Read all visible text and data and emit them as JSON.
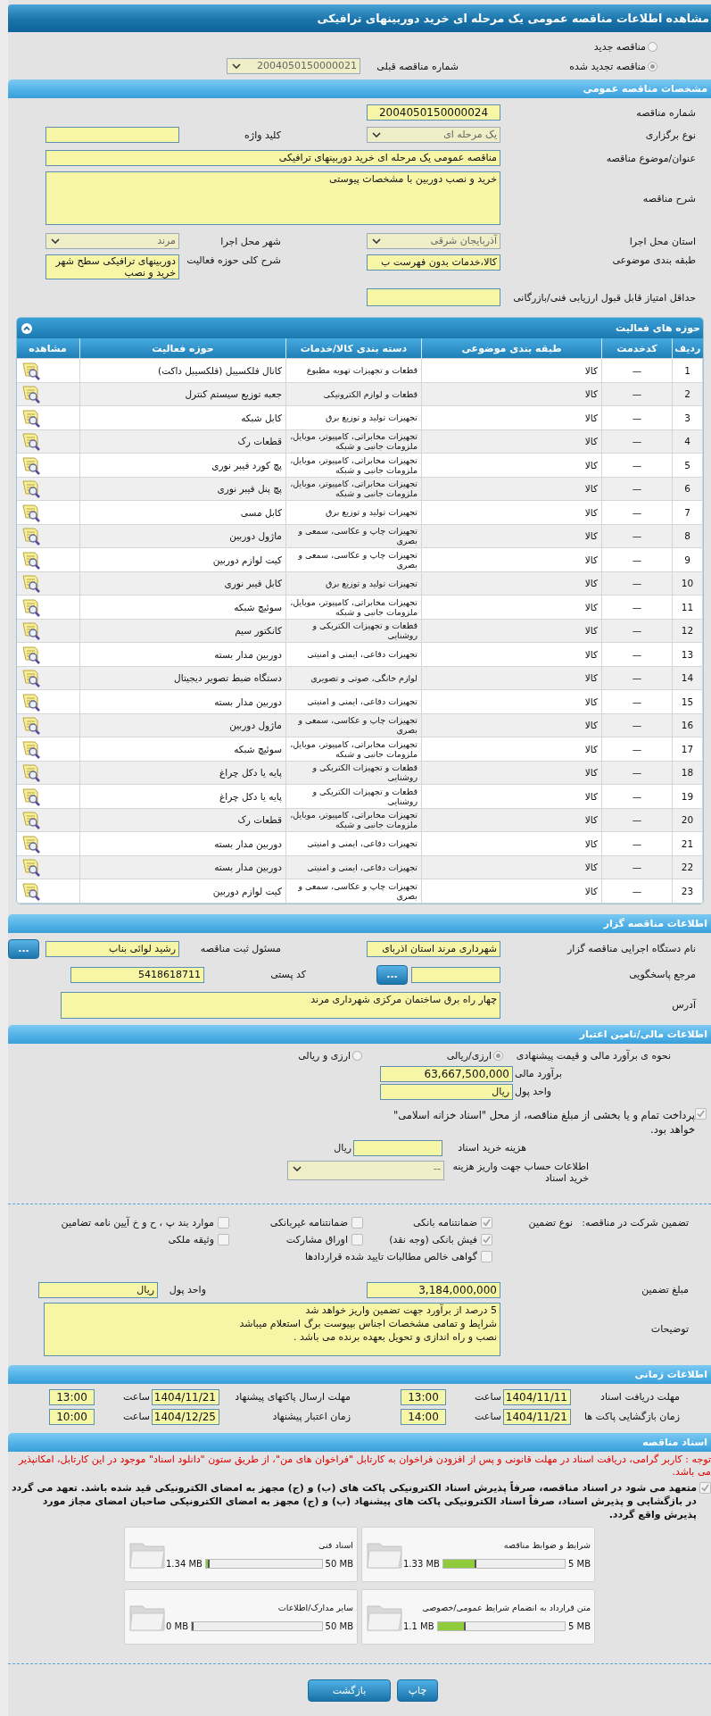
{
  "title": "مشاهده اطلاعات مناقصه عمومی یک مرحله ای خرید دوربینهای ترافیکی",
  "tender_type": [
    {
      "label": "مناقصه جدید",
      "selected": false
    },
    {
      "label": "مناقصه تجدید شده",
      "selected": true
    }
  ],
  "previous_number": {
    "label": "شماره مناقصه قبلی",
    "value": "2004050150000021"
  },
  "general": {
    "title": "مشخصات مناقصه عمومی",
    "number": {
      "label": "شماره مناقصه",
      "value": "2004050150000024"
    },
    "holding_type": {
      "label": "نوع برگزاری",
      "value": "یک مرحله ای"
    },
    "keyword": {
      "label": "کلید واژه"
    },
    "subject": {
      "label": "عنوان/موضوع مناقصه",
      "value": "مناقصه عمومی یک مرحله ای خرید دوربینهای ترافیکی"
    },
    "description": {
      "label": "شرح مناقصه",
      "value": "خرید و نصب دوربین با مشخصات پیوستی"
    },
    "province": {
      "label": "استان محل اجرا",
      "value": "آذربایجان شرقی"
    },
    "city": {
      "label": "شهر محل اجرا",
      "value": "مرند"
    },
    "category": {
      "label": "طبقه بندی موضوعی",
      "value": "کالا،خدمات بدون فهرست ب"
    },
    "activity_summary": {
      "label": "شرح کلی حوزه فعالیت",
      "lines": [
        "دوربینهای ترافیکی سطح شهر",
        "خرید و نصب"
      ]
    },
    "min_score": {
      "label": "حداقل امتیاز قابل قبول ارزیابی فنی/بازرگانی"
    }
  },
  "activities": {
    "title": "حوزه های فعالیت",
    "columns": [
      "ردیف",
      "کدخدمت",
      "طبقه بندی موضوعی",
      "دسته بندی کالا/خدمات",
      "حوزه فعالیت",
      "مشاهده"
    ],
    "rows": [
      {
        "number": "1",
        "code": "—",
        "category": "کالا",
        "group": "قطعات و تجهیزات تهویه مطبوع",
        "activity": "کانال فلکسیبل (فلکسیبل داکت)"
      },
      {
        "number": "2",
        "code": "—",
        "category": "کالا",
        "group": "قطعات و لوازم الکترونیکی",
        "activity": "جعبه توزیع سیستم کنترل"
      },
      {
        "number": "3",
        "code": "—",
        "category": "کالا",
        "group": "تجهیزات تولید و توزیع برق",
        "activity": "کابل شبکه"
      },
      {
        "number": "4",
        "code": "—",
        "category": "کالا",
        "group": "تجهیزات مخابراتی، کامپیوتر، موبایل، ملزومات جانبی و شبکه",
        "activity": "قطعات رک"
      },
      {
        "number": "5",
        "code": "—",
        "category": "کالا",
        "group": "تجهیزات مخابراتی، کامپیوتر، موبایل، ملزومات جانبی و شبکه",
        "activity": "پچ کورد فیبر نوری"
      },
      {
        "number": "6",
        "code": "—",
        "category": "کالا",
        "group": "تجهیزات مخابراتی، کامپیوتر، موبایل، ملزومات جانبی و شبکه",
        "activity": "پچ پنل فیبر نوری"
      },
      {
        "number": "7",
        "code": "—",
        "category": "کالا",
        "group": "تجهیزات تولید و توزیع برق",
        "activity": "کابل مسی"
      },
      {
        "number": "8",
        "code": "—",
        "category": "کالا",
        "group": "تجهیزات چاپ و عکاسی، سمعی و بصری",
        "activity": "ماژول دوربین"
      },
      {
        "number": "9",
        "code": "—",
        "category": "کالا",
        "group": "تجهیزات چاپ و عکاسی، سمعی و بصری",
        "activity": "کیت لوازم دوربین"
      },
      {
        "number": "10",
        "code": "—",
        "category": "کالا",
        "group": "تجهیزات تولید و توزیع برق",
        "activity": "کابل فیبر نوری"
      },
      {
        "number": "11",
        "code": "—",
        "category": "کالا",
        "group": "تجهیزات مخابراتی، کامپیوتر، موبایل، ملزومات جانبی و شبکه",
        "activity": "سوئیچ شبکه"
      },
      {
        "number": "12",
        "code": "—",
        "category": "کالا",
        "group": "قطعات و تجهیزات الکتریکی و روشنایی",
        "activity": "کانکتور سیم"
      },
      {
        "number": "13",
        "code": "—",
        "category": "کالا",
        "group": "تجهیزات دفاعی، ایمنی و امنیتی",
        "activity": "دوربین مدار بسته"
      },
      {
        "number": "14",
        "code": "—",
        "category": "کالا",
        "group": "لوازم خانگی، صوتی و تصویری",
        "activity": "دستگاه ضبط تصویر دیجیتال"
      },
      {
        "number": "15",
        "code": "—",
        "category": "کالا",
        "group": "تجهیزات دفاعی، ایمنی و امنیتی",
        "activity": "دوربین مدار بسته"
      },
      {
        "number": "16",
        "code": "—",
        "category": "کالا",
        "group": "تجهیزات چاپ و عکاسی، سمعی و بصری",
        "activity": "ماژول دوربین"
      },
      {
        "number": "17",
        "code": "—",
        "category": "کالا",
        "group": "تجهیزات مخابراتی، کامپیوتر، موبایل، ملزومات جانبی و شبکه",
        "activity": "سوئیچ شبکه"
      },
      {
        "number": "18",
        "code": "—",
        "category": "کالا",
        "group": "قطعات و تجهیزات الکتریکی و روشنایی",
        "activity": "پایه یا دکل چراغ"
      },
      {
        "number": "19",
        "code": "—",
        "category": "کالا",
        "group": "قطعات و تجهیزات الکتریکی و روشنایی",
        "activity": "پایه یا دکل چراغ"
      },
      {
        "number": "20",
        "code": "—",
        "category": "کالا",
        "group": "تجهیزات مخابراتی، کامپیوتر، موبایل، ملزومات جانبی و شبکه",
        "activity": "قطعات رک"
      },
      {
        "number": "21",
        "code": "—",
        "category": "کالا",
        "group": "تجهیزات دفاعی، ایمنی و امنیتی",
        "activity": "دوربین مدار بسته"
      },
      {
        "number": "22",
        "code": "—",
        "category": "کالا",
        "group": "تجهیزات دفاعی، ایمنی و امنیتی",
        "activity": "دوربین مدار بسته"
      },
      {
        "number": "23",
        "code": "—",
        "category": "کالا",
        "group": "تجهیزات چاپ و عکاسی، سمعی و بصری",
        "activity": "کیت لوازم دوربین"
      }
    ]
  },
  "organizer": {
    "title": "اطلاعات مناقصه گزار",
    "agency": {
      "label": "نام دستگاه اجرایی مناقصه گزار",
      "value": "شهرداری مرند استان اذربای"
    },
    "registrar": {
      "label": "مسئول ثبت مناقصه",
      "value": "رشید لوائی بناب",
      "button": "..."
    },
    "reference": {
      "label": "مرجع پاسخگویی",
      "button": "..."
    },
    "postal_code": {
      "label": "کد پستی",
      "value": "5418618711"
    },
    "address": {
      "label": "آدرس",
      "value": "چهار راه برق ساختمان مرکزی شهرداری مرند"
    }
  },
  "finance": {
    "title": "اطلاعات مالی/تامین اعتبار",
    "method": {
      "label": "نحوه ی برآورد مالی و قیمت پیشنهادی",
      "options": [
        {
          "label": "ارزی/ریالی",
          "selected": true
        },
        {
          "label": "ارزی و ریالی",
          "selected": false
        }
      ]
    },
    "estimate": {
      "label": "برآورد مالی",
      "value": "63,667,500,000"
    },
    "currency": {
      "label": "واحد پول",
      "value": "ریال"
    },
    "treasury": {
      "checked": true,
      "text": "پرداخت تمام و یا بخشی از مبلغ مناقصه، از محل \"اسناد خزانه اسلامی\" خواهد بود."
    },
    "document_cost": {
      "label": "هزینه خرید اسناد",
      "unit": "ریال"
    },
    "account": {
      "label": "اطلاعات حساب جهت واریز هزینه خرید اسناد",
      "value": "--"
    }
  },
  "guarantee": {
    "label": "تضمین شرکت در مناقصه:",
    "type_label": "نوع تضمین",
    "options": [
      {
        "label": "ضمانتنامه بانکی",
        "checked": true
      },
      {
        "label": "ضمانتنامه غیربانکی",
        "checked": false
      },
      {
        "label": "موارد بند پ ، ح و خ آیین نامه تضامین",
        "checked": false
      },
      {
        "label": "فیش بانکی (وجه نقد)",
        "checked": true
      },
      {
        "label": "اوراق مشارکت",
        "checked": false
      },
      {
        "label": "وثیقه ملکی",
        "checked": false
      },
      {
        "label": "گواهی خالص مطالبات تایید شده قراردادها",
        "checked": false
      }
    ],
    "amount": {
      "label": "مبلغ تضمین",
      "value": "3,184,000,000"
    },
    "currency": {
      "label": "واحد پول",
      "value": "ریال"
    },
    "notes": {
      "label": "توضیحات",
      "lines": [
        "5 درصد از برآورد جهت تضمین واریز خواهد شد",
        "شرایط و تمامی مشخصات اجناس بپیوست برگ استعلام میباشد",
        "نصب و راه اندازی و تحویل بعهده برنده می باشد ."
      ]
    }
  },
  "schedule": {
    "title": "اطلاعات زمانی",
    "items": [
      {
        "label": "مهلت دریافت اسناد",
        "date": "1404/11/11",
        "time_label": "ساعت",
        "time": "13:00"
      },
      {
        "label": "مهلت ارسال پاکتهای پیشنهاد",
        "date": "1404/11/21",
        "time_label": "ساعت",
        "time": "13:00"
      },
      {
        "label": "زمان بازگشایی پاکت ها",
        "date": "1404/11/21",
        "time_label": "ساعت",
        "time": "14:00"
      },
      {
        "label": "زمان اعتبار پیشنهاد",
        "date": "1404/12/25",
        "time_label": "ساعت",
        "time": "10:00"
      }
    ]
  },
  "documents": {
    "title": "اسناد مناقصه",
    "notice": "توجه : کاربر گرامی، دریافت اسناد در مهلت قانونی و پس از افزودن فراخوان به کارتابل \"فراخوان های من\"، از طریق ستون \"دانلود اسناد\" موجود در این کارتابل، امکانپذیر می باشد.",
    "commitment": {
      "checked": true,
      "text": "متعهد می شود در اسناد مناقصه، صرفاً پذیرش اسناد الکترونیکی پاکت های (ب) و (ج) مجهز به امضای الکترونیکی قید شده باشد. تعهد می گردد در بازگشایی و پذیرش اسناد، صرفاً اسناد الکترونیکی پاکت های پیشنهاد (ب) و (ج) مجهز به امضای الکترونیکی صاحبان امضای مجاز مورد پذیرش واقع گردد."
    },
    "files": [
      {
        "name": "شرایط و ضوابط مناقصه",
        "max": "5 MB",
        "size": "1.33 MB",
        "level": 0.27
      },
      {
        "name": "اسناد فنی",
        "max": "50 MB",
        "size": "1.34 MB",
        "level": 0.03
      },
      {
        "name": "متن قرارداد به انضمام شرایط عمومی/خصوصی",
        "max": "5 MB",
        "size": "1.1 MB",
        "level": 0.22
      },
      {
        "name": "سایر مدارک/اطلاعات",
        "max": "50 MB",
        "size": "0 MB",
        "level": 0
      }
    ]
  },
  "buttons": [
    "چاپ",
    "بازگشت"
  ]
}
